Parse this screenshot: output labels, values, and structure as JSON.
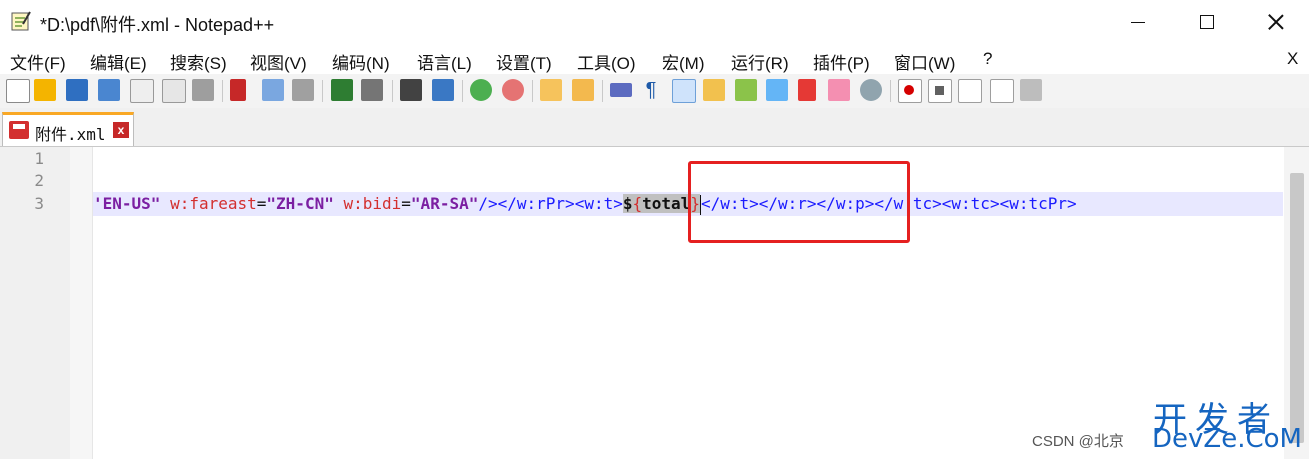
{
  "window": {
    "title": "*D:\\pdf\\附件.xml - Notepad++"
  },
  "menu": {
    "items": [
      "文件(F)",
      "编辑(E)",
      "搜索(S)",
      "视图(V)",
      "编码(N)",
      "语言(L)",
      "设置(T)",
      "工具(O)",
      "宏(M)",
      "运行(R)",
      "插件(P)",
      "窗口(W)",
      "?"
    ],
    "close_label": "X"
  },
  "toolbar": {
    "icons": [
      "new-file-icon",
      "open-file-icon",
      "save-icon",
      "save-all-icon",
      "close-icon",
      "close-all-icon",
      "print-icon",
      "cut-icon",
      "copy-icon",
      "paste-icon",
      "undo-icon",
      "redo-icon",
      "find-icon",
      "replace-icon",
      "zoom-in-icon",
      "zoom-out-icon",
      "sync-vertical-icon",
      "sync-horizontal-icon",
      "word-wrap-icon",
      "show-all-chars-icon",
      "indent-guide-icon",
      "doc-map-icon",
      "function-list-icon",
      "clipboard-icon",
      "folder-icon",
      "monitor-icon",
      "record-macro-icon",
      "stop-macro-icon",
      "play-macro-icon",
      "run-macro-multiple-icon",
      "save-macro-icon"
    ]
  },
  "tab": {
    "label": "附件.xml",
    "close": "x"
  },
  "editor": {
    "line_numbers": [
      "1",
      "2",
      "3"
    ],
    "line3": {
      "s1": "'EN-US\"",
      "s2": " w:fareast",
      "s3": "=",
      "s4": "\"ZH-CN\"",
      "s5": " w:bidi",
      "s6": "=",
      "s7": "\"AR-SA\"",
      "s8": "/></w:rPr><w:t>",
      "s9": "$",
      "s10": "{",
      "s11": "total",
      "s12": "}",
      "s13": "</w:t></w:r></w:p></w:tc><w:tc><w:tcPr>"
    }
  },
  "watermark": {
    "brand": "开发者",
    "credit": "CSDN @北京",
    "site": "DevZe.CoM"
  },
  "colors": {
    "annotation": "#e52020",
    "tag": "#1a1aff",
    "attribute": "#d32f2f",
    "value": "#7b1fa2",
    "line_highlight": "#e8e8ff"
  }
}
